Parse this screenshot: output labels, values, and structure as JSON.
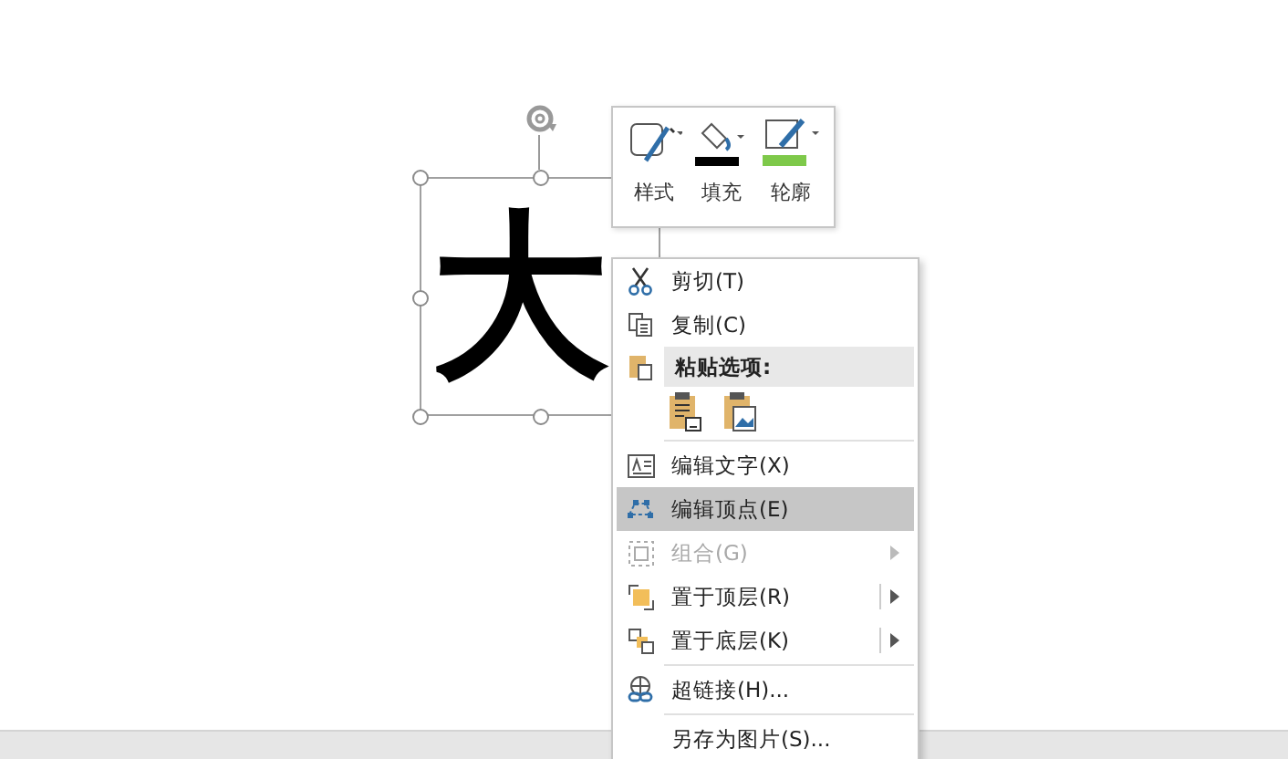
{
  "shape": {
    "text": "大"
  },
  "mini_toolbar": [
    {
      "kind": "style",
      "label": "样式"
    },
    {
      "kind": "fill",
      "label": "填充"
    },
    {
      "kind": "outline",
      "label": "轮廓"
    }
  ],
  "context_menu": [
    {
      "kind": "item",
      "label": "剪切(T)",
      "selected": false,
      "disabled": false,
      "submenu": false
    },
    {
      "kind": "item",
      "label": "复制(C)",
      "selected": false,
      "disabled": false,
      "submenu": false
    },
    {
      "kind": "header",
      "label": "粘贴选项:"
    },
    {
      "kind": "paste_options"
    },
    {
      "kind": "separator"
    },
    {
      "kind": "item",
      "label": "编辑文字(X)",
      "selected": false,
      "disabled": false,
      "submenu": false
    },
    {
      "kind": "item",
      "label": "编辑顶点(E)",
      "selected": true,
      "disabled": false,
      "submenu": false
    },
    {
      "kind": "item",
      "label": "组合(G)",
      "selected": false,
      "disabled": true,
      "submenu": true,
      "split": false
    },
    {
      "kind": "item",
      "label": "置于顶层(R)",
      "selected": false,
      "disabled": false,
      "submenu": true,
      "split": true
    },
    {
      "kind": "item",
      "label": "置于底层(K)",
      "selected": false,
      "disabled": false,
      "submenu": true,
      "split": true
    },
    {
      "kind": "separator"
    },
    {
      "kind": "item",
      "label": "超链接(H)...",
      "selected": false,
      "disabled": false,
      "submenu": false
    },
    {
      "kind": "separator"
    },
    {
      "kind": "item",
      "label": "另存为图片(S)...",
      "selected": false,
      "disabled": false,
      "submenu": false
    }
  ]
}
